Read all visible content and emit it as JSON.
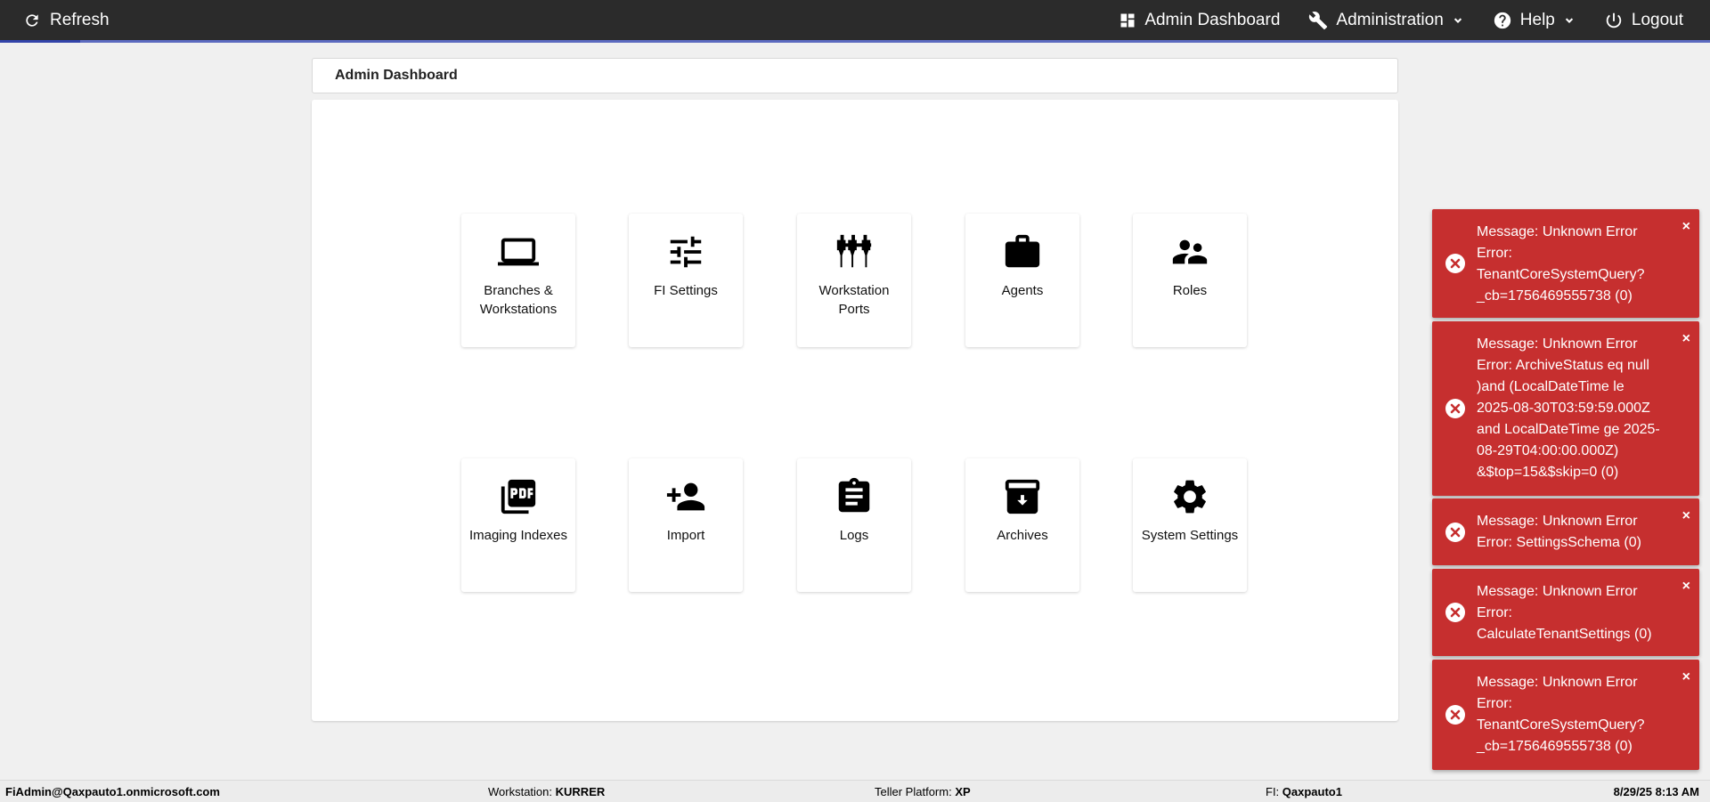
{
  "topbar": {
    "refresh_label": "Refresh",
    "nav": {
      "dashboard": "Admin Dashboard",
      "administration": "Administration",
      "help": "Help",
      "logout": "Logout"
    },
    "progress_fraction": 0.047
  },
  "page": {
    "title": "Admin Dashboard"
  },
  "tiles": [
    {
      "label": "Branches & Workstations",
      "icon": "laptop-icon"
    },
    {
      "label": "FI Settings",
      "icon": "tune-icon"
    },
    {
      "label": "Workstation Ports",
      "icon": "ports-icon"
    },
    {
      "label": "Agents",
      "icon": "briefcase-icon"
    },
    {
      "label": "Roles",
      "icon": "people-icon"
    },
    {
      "label": "Imaging Indexes",
      "icon": "pdf-icon"
    },
    {
      "label": "Import",
      "icon": "person-add-icon"
    },
    {
      "label": "Logs",
      "icon": "clipboard-icon"
    },
    {
      "label": "Archives",
      "icon": "archive-icon"
    },
    {
      "label": "System Settings",
      "icon": "gear-icon"
    }
  ],
  "toasts": [
    {
      "text": "Message: Unknown Error Error: TenantCoreSystemQuery?_cb=1756469555738 (0)"
    },
    {
      "text": "Message: Unknown Error Error: ArchiveStatus eq null )and (LocalDateTime le 2025-08-30T03:59:59.000Z and LocalDateTime ge 2025-08-29T04:00:00.000Z) &$top=15&$skip=0 (0)"
    },
    {
      "text": "Message: Unknown Error Error: SettingsSchema (0)"
    },
    {
      "text": "Message: Unknown Error Error: CalculateTenantSettings (0)"
    },
    {
      "text": "Message: Unknown Error Error: TenantCoreSystemQuery?_cb=1756469555738 (0)"
    }
  ],
  "toast_close": "×",
  "statusbar": {
    "user": "FiAdmin@Qaxpauto1.onmicrosoft.com",
    "workstation_label": "Workstation:",
    "workstation_value": "KURRER",
    "teller_label": "Teller Platform:",
    "teller_value": "XP",
    "fi_label": "FI:",
    "fi_value": "Qaxpauto1",
    "datetime": "8/29/25 8:13 AM"
  },
  "colors": {
    "topbar": "#2b2b2b",
    "toast": "#c62f2f",
    "progress": "#5c6bc0"
  }
}
